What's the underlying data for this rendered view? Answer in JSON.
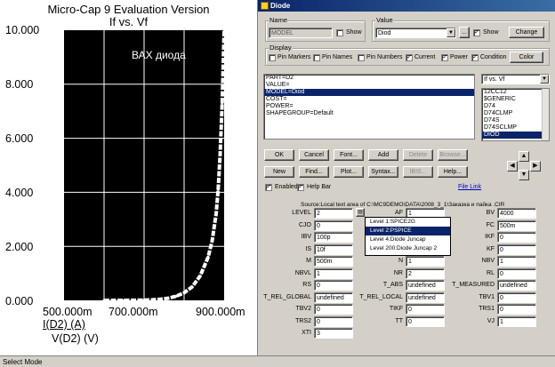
{
  "plot": {
    "title_line1": "Micro-Cap 9 Evaluation Version",
    "title_line2": "If vs. Vf",
    "annotation": "ВАХ диода",
    "x_label": "V(D2) (V)",
    "y_label": "I(D2) (A)",
    "colors": {
      "background": "#000000",
      "curve": "#ffffff",
      "grid": "#ffffff"
    }
  },
  "chart_data": {
    "type": "line",
    "title": "If vs. Vf",
    "xlabel": "V(D2) (V)",
    "ylabel": "I(D2) (A)",
    "xlim": [
      0.5,
      0.9
    ],
    "ylim": [
      0,
      10
    ],
    "x_ticks": [
      "500.000m",
      "700.000m",
      "900.000m"
    ],
    "y_ticks": [
      "10.000",
      "8.000",
      "6.000",
      "4.000",
      "2.000",
      "0.000"
    ],
    "grid": true,
    "series": [
      {
        "x": [
          0.6,
          0.65,
          0.7,
          0.72,
          0.74,
          0.76,
          0.78,
          0.8,
          0.82,
          0.84,
          0.86,
          0.87,
          0.88,
          0.885,
          0.89,
          0.895,
          0.9
        ],
        "values": [
          0.0,
          0.0,
          0.01,
          0.02,
          0.04,
          0.08,
          0.15,
          0.28,
          0.5,
          0.9,
          1.6,
          2.2,
          3.2,
          4.1,
          5.4,
          7.3,
          10.0
        ]
      }
    ]
  },
  "dialog": {
    "title": "Diode",
    "name_group_label": "Name",
    "name_value": "MODEL",
    "name_show_label": "Show",
    "value_group_label": "Value",
    "value_value": "Diod",
    "value_more": "...",
    "value_show_label": "Show",
    "change_label": "Change",
    "display_group_label": "Display",
    "display_checks": [
      {
        "label": "Pin Markers",
        "checked": false
      },
      {
        "label": "Pin Names",
        "checked": false
      },
      {
        "label": "Pin Numbers",
        "checked": false
      },
      {
        "label": "Current",
        "checked": true
      },
      {
        "label": "Power",
        "checked": true
      },
      {
        "label": "Condition",
        "checked": true
      }
    ],
    "color_label": "Color",
    "attributes": [
      "PART=D2",
      "VALUE=",
      "MODEL=Diod",
      "COST=",
      "POWER=",
      "SHAPEGROUP=Default"
    ],
    "attributes_selected": 2,
    "plot_select_value": "If vs. Vf",
    "models": [
      "12CC12",
      "$GENERIC",
      "D74",
      "D74CLMP",
      "D74S",
      "D74SCLMP",
      "DIOD"
    ],
    "models_selected": 6,
    "buttons_row1": [
      {
        "label": "OK",
        "disabled": false
      },
      {
        "label": "Cancel",
        "disabled": false
      },
      {
        "label": "Font...",
        "disabled": false
      },
      {
        "label": "Add",
        "disabled": false
      },
      {
        "label": "Delete",
        "disabled": true
      },
      {
        "label": "Browse...",
        "disabled": true
      }
    ],
    "buttons_row2": [
      {
        "label": "New",
        "disabled": false
      },
      {
        "label": "Find...",
        "disabled": false
      },
      {
        "label": "Plot...",
        "disabled": false
      },
      {
        "label": "Syntax...",
        "disabled": false
      },
      {
        "label": "IBIS...",
        "disabled": true
      },
      {
        "label": "Help...",
        "disabled": false
      }
    ],
    "enabled_label": "Enabled",
    "helpbar_label": "Help Bar",
    "file_link_label": "File Link",
    "source_text": "Source:Local text area of C:\\MC9DEMO\\DATA\\2008_3_1\\Заказка и пайка .CIR",
    "params": [
      {
        "label": "LEVEL",
        "value": "2",
        "label2": "AF",
        "value2": "1",
        "label3": "BV",
        "value3": "4000"
      },
      {
        "label": "CJO",
        "value": "0",
        "label2": "",
        "value2": "",
        "label3": "FC",
        "value3": "500m"
      },
      {
        "label": "IBV",
        "value": "100p",
        "label2": "",
        "value2": "",
        "label3": "IKF",
        "value3": "0"
      },
      {
        "label": "IS",
        "value": "10f",
        "label2": "",
        "value2": "",
        "label3": "KF",
        "value3": "0"
      },
      {
        "label": "M",
        "value": "500m",
        "label2": "N",
        "value2": "1",
        "label3": "NBV",
        "value3": "1"
      },
      {
        "label": "NBVL",
        "value": "1",
        "label2": "NR",
        "value2": "2",
        "label3": "RL",
        "value3": "0"
      },
      {
        "label": "RS",
        "value": "0",
        "label2": "T_ABS",
        "value2": "undefined",
        "label3": "T_MEASURED",
        "value3": "undefined"
      },
      {
        "label": "T_REL_GLOBAL",
        "value": "undefined",
        "label2": "T_REL_LOCAL",
        "value2": "undefined",
        "label3": "TBV1",
        "value3": "0"
      },
      {
        "label": "TBV2",
        "value": "0",
        "label2": "TIKF",
        "value2": "0",
        "label3": "TRS1",
        "value3": "0"
      },
      {
        "label": "TRS2",
        "value": "0",
        "label2": "TT",
        "value2": "0",
        "label3": "VJ",
        "value3": "1"
      },
      {
        "label": "XTI",
        "value": "3",
        "label2": "",
        "value2": "",
        "label3": "",
        "value3": ""
      }
    ],
    "level_popup": [
      "Level 1:SPICE2G",
      "Level 2:PSPICE",
      "Level 4:Diode Juncap",
      "Level 200:Diode Juncap 2"
    ],
    "level_popup_selected": 1
  },
  "status": {
    "text": "Select Mode"
  }
}
